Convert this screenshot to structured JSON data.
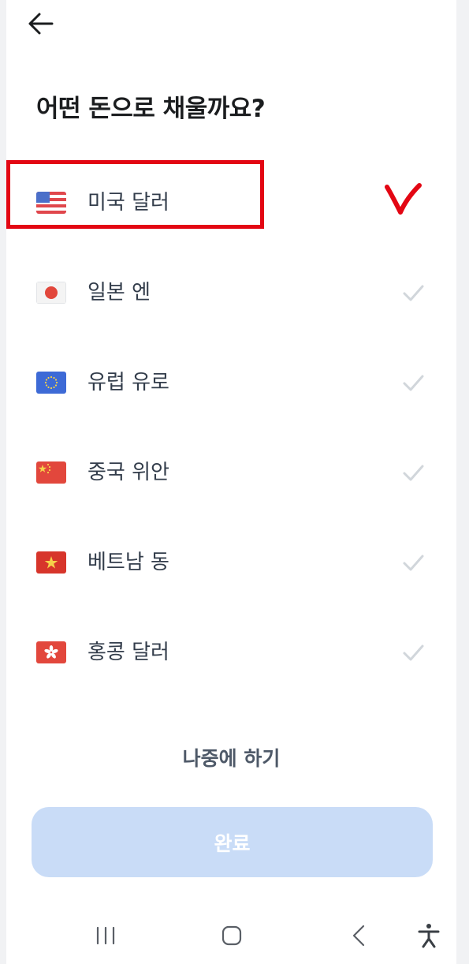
{
  "header": {
    "back_icon": "arrow-left-icon",
    "title": "어떤 돈으로 채울까요?"
  },
  "currencies": [
    {
      "label": "미국 달러",
      "flag": "us-flag-icon",
      "selected": true
    },
    {
      "label": "일본 엔",
      "flag": "jp-flag-icon",
      "selected": false
    },
    {
      "label": "유럽 유로",
      "flag": "eu-flag-icon",
      "selected": false
    },
    {
      "label": "중국 위안",
      "flag": "cn-flag-icon",
      "selected": false
    },
    {
      "label": "베트남 동",
      "flag": "vn-flag-icon",
      "selected": false
    },
    {
      "label": "홍콩 달러",
      "flag": "hk-flag-icon",
      "selected": false
    }
  ],
  "later_label": "나중에 하기",
  "done_label": "완료",
  "colors": {
    "accent_disabled": "#c9dcf7",
    "check_gray": "#d1d6db",
    "annotation_red": "#e30613"
  },
  "system_nav": {
    "recents_icon": "recents-icon",
    "home_icon": "home-icon",
    "back_icon": "chevron-left-icon",
    "accessibility_icon": "accessibility-icon"
  }
}
